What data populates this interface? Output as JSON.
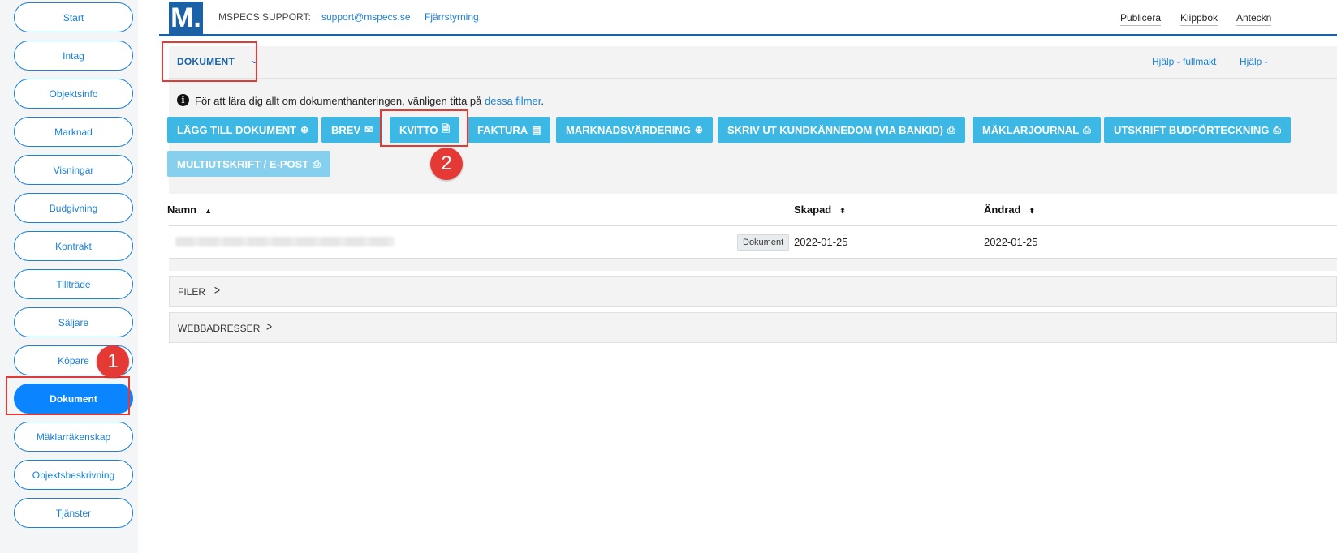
{
  "sidebar": {
    "items": [
      {
        "label": "Start"
      },
      {
        "label": "Intag"
      },
      {
        "label": "Objektsinfo"
      },
      {
        "label": "Marknad"
      },
      {
        "label": "Visningar"
      },
      {
        "label": "Budgivning"
      },
      {
        "label": "Kontrakt"
      },
      {
        "label": "Tillträde"
      },
      {
        "label": "Säljare"
      },
      {
        "label": "Köpare"
      },
      {
        "label": "Dokument",
        "active": true
      },
      {
        "label": "Mäklarräkenskap"
      },
      {
        "label": "Objektsbeskrivning"
      },
      {
        "label": "Tjänster"
      }
    ]
  },
  "header": {
    "logo": "M.",
    "support_label": "MSPECS SUPPORT:",
    "support_email": "support@mspecs.se",
    "remote_link": "Fjärrstyrning",
    "right_links": [
      "Publicera",
      "Klippbok",
      "Anteckn"
    ]
  },
  "section": {
    "title": "DOKUMENT",
    "help_links": [
      "Hjälp - fullmakt",
      "Hjälp -"
    ]
  },
  "info": {
    "icon": "i",
    "text": "För att lära dig allt om dokumenthanteringen, vänligen titta på ",
    "link": "dessa filmer",
    "end": "."
  },
  "actions": [
    {
      "label": "LÄGG TILL DOKUMENT",
      "icon": "⊕"
    },
    {
      "label": "BREV",
      "icon": "✉"
    },
    {
      "label": "KVITTO",
      "icon": "🗎"
    },
    {
      "label": "FAKTURA",
      "icon": "▤"
    },
    {
      "label": "MARKNADSVÄRDERING",
      "icon": "⊕"
    },
    {
      "label": "SKRIV UT KUNDKÄNNEDOM (VIA BANKID)",
      "icon": "⎙"
    },
    {
      "label": "MÄKLARJOURNAL",
      "icon": "⎙"
    },
    {
      "label": "UTSKRIFT BUDFÖRTECKNING",
      "icon": "⎙"
    },
    {
      "label": "MULTIUTSKRIFT / E-POST",
      "icon": "⎙"
    }
  ],
  "table": {
    "columns": [
      "Namn",
      "Skapad",
      "Ändrad"
    ],
    "rows": [
      {
        "badge": "Dokument",
        "created": "2022-01-25",
        "changed": "2022-01-25"
      }
    ]
  },
  "collapsibles": [
    "FILER",
    "WEBBADRESSER"
  ],
  "annotations": [
    "1",
    "2"
  ],
  "colors": {
    "accent": "#1a62a5",
    "button": "#3db7e4",
    "sidebar_active": "#0a84ff",
    "highlight": "#e53935"
  }
}
